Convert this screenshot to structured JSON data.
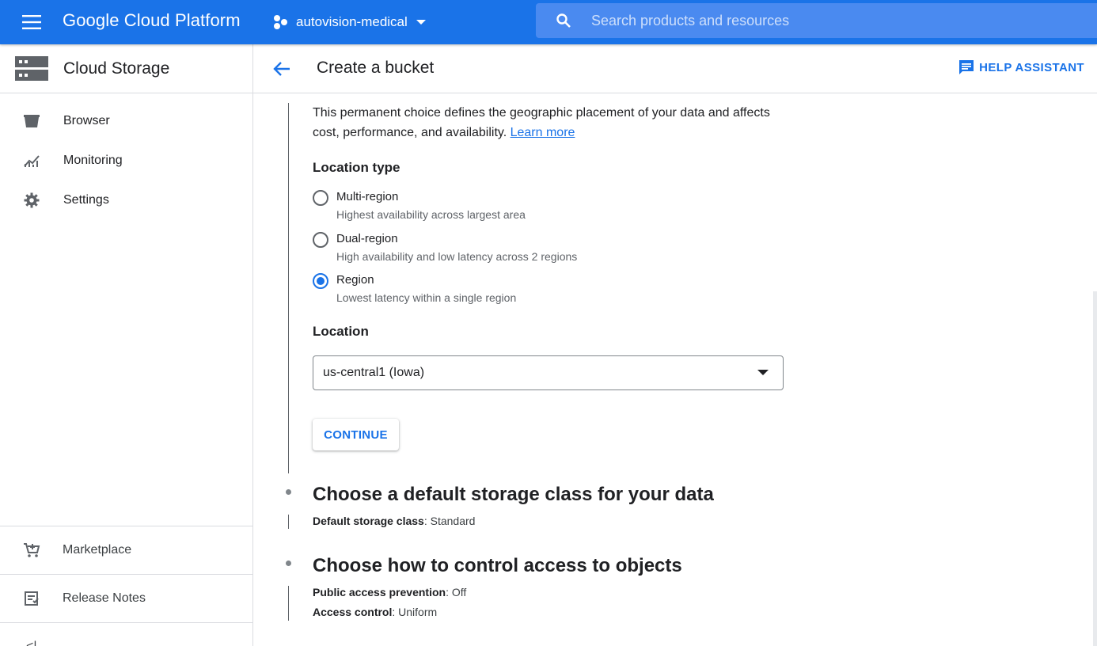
{
  "topbar": {
    "brand": "Google Cloud Platform",
    "project": "autovision-medical",
    "search_placeholder": "Search products and resources"
  },
  "sidebar": {
    "product_title": "Cloud Storage",
    "items": [
      {
        "label": "Browser",
        "icon": "bucket-icon"
      },
      {
        "label": "Monitoring",
        "icon": "monitoring-chart-icon"
      },
      {
        "label": "Settings",
        "icon": "gear-icon"
      }
    ],
    "bottom_items": [
      {
        "label": "Marketplace",
        "icon": "cart-icon"
      },
      {
        "label": "Release Notes",
        "icon": "release-notes-icon"
      }
    ],
    "collapse_glyph": "<|"
  },
  "header": {
    "title": "Create a bucket",
    "help_label": "HELP ASSISTANT"
  },
  "location_step": {
    "description": "This permanent choice defines the geographic placement of your data and affects cost, performance, and availability.",
    "learn_more": "Learn more",
    "location_type_title": "Location type",
    "options": [
      {
        "label": "Multi-region",
        "sub": "Highest availability across largest area",
        "checked": false
      },
      {
        "label": "Dual-region",
        "sub": "High availability and low latency across 2 regions",
        "checked": false
      },
      {
        "label": "Region",
        "sub": "Lowest latency within a single region",
        "checked": true
      }
    ],
    "location_title": "Location",
    "location_value": "us-central1 (Iowa)",
    "continue_label": "CONTINUE"
  },
  "storage_class_step": {
    "title": "Choose a default storage class for your data",
    "key": "Default storage class",
    "value": ": Standard"
  },
  "access_step": {
    "title": "Choose how to control access to objects",
    "rows": [
      {
        "key": "Public access prevention",
        "value": ": Off"
      },
      {
        "key": "Access control",
        "value": ": Uniform"
      }
    ]
  },
  "colors": {
    "topbar": "#1a73e8",
    "accent": "#1a73e8"
  }
}
